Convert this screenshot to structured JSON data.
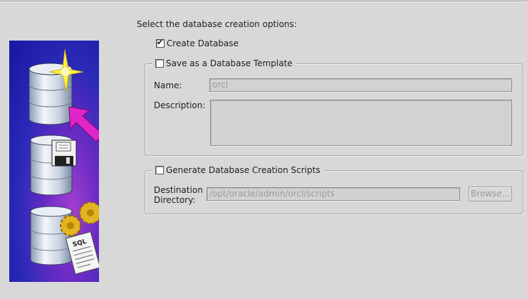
{
  "prompt": "Select the database creation options:",
  "create_database": {
    "label": "Create Database",
    "checked": true
  },
  "template_group": {
    "label": "Save as a Database Template",
    "checked": false,
    "name_label": "Name:",
    "name_value": "orcl",
    "description_label": "Description:",
    "description_value": ""
  },
  "scripts_group": {
    "label": "Generate Database Creation Scripts",
    "checked": false,
    "dest_label_line1": "Destination",
    "dest_label_line2": "Directory:",
    "dest_value": "/opt/oracle/admin/orcl/scripts",
    "browse_label": "Browse..."
  },
  "side_image": {
    "icons": [
      "database-star-icon",
      "arrow-icon",
      "database-floppy-icon",
      "database-gears-sql-icon"
    ],
    "sql_text": "SQL"
  }
}
